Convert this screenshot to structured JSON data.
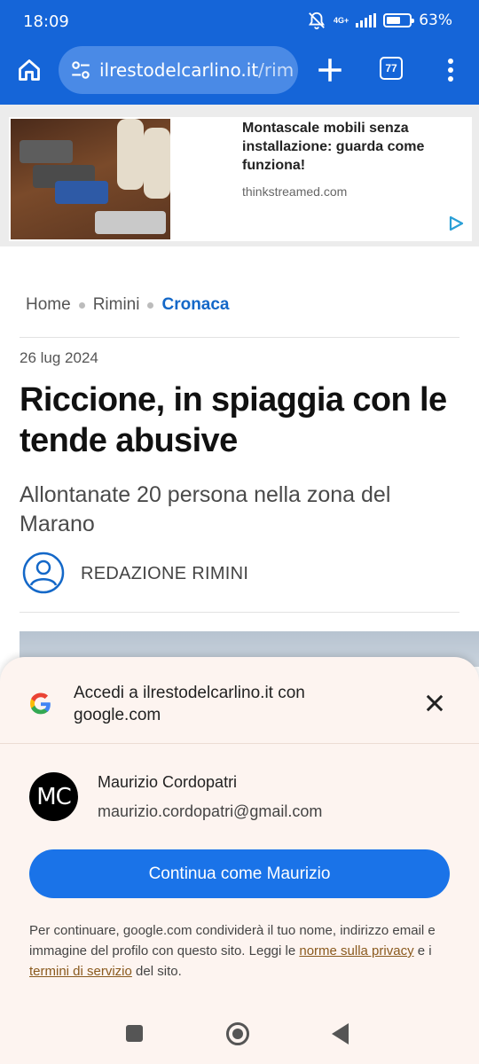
{
  "status_bar": {
    "time": "18:09",
    "network": "4G+",
    "battery_percent": "63%",
    "battery_level": 0.63
  },
  "browser": {
    "url_host": "ilrestodelcarlino.it",
    "url_path": "/rim",
    "tab_count": "77",
    "icons": [
      "home-icon",
      "site-settings-icon",
      "plus-icon",
      "tab-switcher-icon",
      "more-icon"
    ]
  },
  "ad": {
    "title": "Montascale mobili senza installazione: guarda come funziona!",
    "domain": "thinkstreamed.com",
    "icon": "ad-choices-icon"
  },
  "breadcrumb": [
    "Home",
    "Rimini",
    "Cronaca"
  ],
  "article": {
    "date": "26 lug 2024",
    "headline": "Riccione, in spiaggia con le tende abusive",
    "subheadline": "Allontanate 20 persona nella zona del Marano",
    "author": "REDAZIONE RIMINI"
  },
  "signin_sheet": {
    "title": "Accedi a ilrestodelcarlino.it con google.com",
    "account_initials": "MC",
    "account_name": "Maurizio Cordopatri",
    "account_email": "maurizio.cordopatri@gmail.com",
    "continue_label": "Continua come Maurizio",
    "legal_text_1": "Per continuare, google.com condividerà il tuo nome, indirizzo email e immagine del profilo con questo sito. Leggi le",
    "privacy_link": "norme sulla privacy",
    "legal_text_2": "e i",
    "terms_link": "termini di servizio",
    "legal_text_3": "del sito.",
    "colors": {
      "button": "#1a73e8",
      "sheet_bg": "#fdf4f0"
    }
  },
  "colors": {
    "toolbar": "#1565d8",
    "breadcrumb_active": "#1468c8"
  }
}
